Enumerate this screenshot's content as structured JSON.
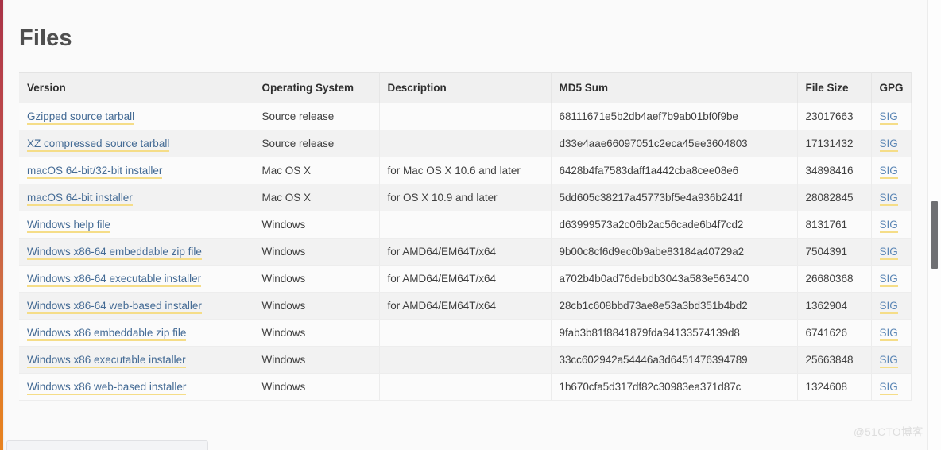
{
  "page": {
    "title": "Files",
    "watermark": "@51CTO博客",
    "accent_stripe_top": "#a83246",
    "accent_stripe_bottom": "#e8831f",
    "link_color": "#436a94",
    "link_underline_color": "#f5dd88",
    "header_bg": "#f0f0f0"
  },
  "table": {
    "columns": [
      {
        "key": "version",
        "label": "Version"
      },
      {
        "key": "os",
        "label": "Operating System"
      },
      {
        "key": "description",
        "label": "Description"
      },
      {
        "key": "md5",
        "label": "MD5 Sum"
      },
      {
        "key": "size",
        "label": "File Size"
      },
      {
        "key": "gpg",
        "label": "GPG"
      }
    ],
    "gpg_label": "SIG",
    "rows": [
      {
        "version": "Gzipped source tarball",
        "os": "Source release",
        "description": "",
        "md5": "68111671e5b2db4aef7b9ab01bf0f9be",
        "size": "23017663",
        "gpg": "SIG"
      },
      {
        "version": "XZ compressed source tarball",
        "os": "Source release",
        "description": "",
        "md5": "d33e4aae66097051c2eca45ee3604803",
        "size": "17131432",
        "gpg": "SIG"
      },
      {
        "version": "macOS 64-bit/32-bit installer",
        "os": "Mac OS X",
        "description": "for Mac OS X 10.6 and later",
        "md5": "6428b4fa7583daff1a442cba8cee08e6",
        "size": "34898416",
        "gpg": "SIG"
      },
      {
        "version": "macOS 64-bit installer",
        "os": "Mac OS X",
        "description": "for OS X 10.9 and later",
        "md5": "5dd605c38217a45773bf5e4a936b241f",
        "size": "28082845",
        "gpg": "SIG"
      },
      {
        "version": "Windows help file",
        "os": "Windows",
        "description": "",
        "md5": "d63999573a2c06b2ac56cade6b4f7cd2",
        "size": "8131761",
        "gpg": "SIG"
      },
      {
        "version": "Windows x86-64 embeddable zip file",
        "os": "Windows",
        "description": "for AMD64/EM64T/x64",
        "md5": "9b00c8cf6d9ec0b9abe83184a40729a2",
        "size": "7504391",
        "gpg": "SIG"
      },
      {
        "version": "Windows x86-64 executable installer",
        "os": "Windows",
        "description": "for AMD64/EM64T/x64",
        "md5": "a702b4b0ad76debdb3043a583e563400",
        "size": "26680368",
        "gpg": "SIG"
      },
      {
        "version": "Windows x86-64 web-based installer",
        "os": "Windows",
        "description": "for AMD64/EM64T/x64",
        "md5": "28cb1c608bbd73ae8e53a3bd351b4bd2",
        "size": "1362904",
        "gpg": "SIG"
      },
      {
        "version": "Windows x86 embeddable zip file",
        "os": "Windows",
        "description": "",
        "md5": "9fab3b81f8841879fda94133574139d8",
        "size": "6741626",
        "gpg": "SIG"
      },
      {
        "version": "Windows x86 executable installer",
        "os": "Windows",
        "description": "",
        "md5": "33cc602942a54446a3d6451476394789",
        "size": "25663848",
        "gpg": "SIG"
      },
      {
        "version": "Windows x86 web-based installer",
        "os": "Windows",
        "description": "",
        "md5": "1b670cfa5d317df82c30983ea371d87c",
        "size": "1324608",
        "gpg": "SIG"
      }
    ]
  }
}
